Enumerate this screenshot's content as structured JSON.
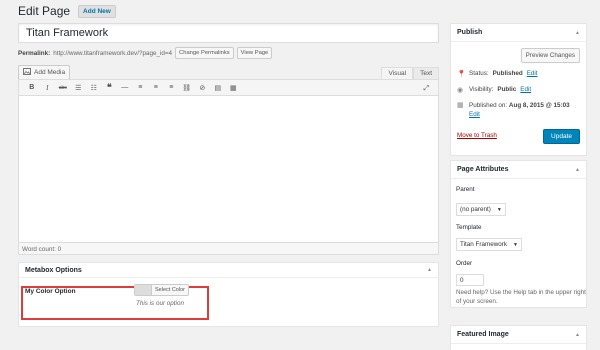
{
  "header": {
    "title": "Edit Page",
    "add_new": "Add New"
  },
  "post": {
    "title": "Titan Framework"
  },
  "permalink": {
    "label": "Permalink:",
    "url": "http://www.titanframework.dev/?page_id=4",
    "change_btn": "Change Permalinks",
    "view_btn": "View Page"
  },
  "editor": {
    "add_media": "Add Media",
    "tabs": [
      "Visual",
      "Text"
    ],
    "word_count": "Word count: 0"
  },
  "metabox": {
    "title": "Metabox Options",
    "option_label": "My Color Option",
    "select_color": "Select Color",
    "description": "This is our option"
  },
  "publish": {
    "title": "Publish",
    "preview": "Preview Changes",
    "status_label": "Status:",
    "status_value": "Published",
    "visibility_label": "Visibility:",
    "visibility_value": "Public",
    "published_label": "Published on:",
    "published_value": "Aug 8, 2015 @ 15:03",
    "edit": "Edit",
    "trash": "Move to Trash",
    "update": "Update"
  },
  "attributes": {
    "title": "Page Attributes",
    "parent_label": "Parent",
    "parent_value": "(no parent)",
    "template_label": "Template",
    "template_value": "Titan Framework",
    "order_label": "Order",
    "order_value": "0",
    "help": "Need help? Use the Help tab in the upper right of your screen."
  },
  "featured": {
    "title": "Featured Image"
  }
}
